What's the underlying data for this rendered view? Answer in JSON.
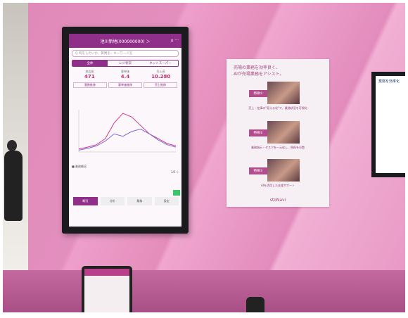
{
  "app": {
    "store_name": "池川新地(000000000) ＞",
    "header_icons": "⌂ ···",
    "search_placeholder": "Q 何をしたいか、質問を、キーワードを",
    "tabs": [
      "全体",
      "レジ状況",
      "ネットスーパー"
    ],
    "stats": [
      {
        "label": "来店客",
        "value": "471"
      },
      {
        "label": "客単価",
        "value": "4.4"
      },
      {
        "label": "売上高",
        "value": "10.280"
      }
    ],
    "subtabs": [
      "客数推移",
      "客単価推移",
      "売上推移"
    ],
    "footer_label": "■ 業務概況",
    "footer_right": "1/5 >",
    "buttons": [
      "概況",
      "分析",
      "業務",
      "設定"
    ]
  },
  "poster": {
    "title_line1": "売場の業務を効率良く、",
    "title_line2": "AIが売場業務をアシスト。",
    "features": [
      {
        "badge": "特徴①",
        "desc": "売上・在庫の\"見える化\"で、業務状況を可視化"
      },
      {
        "badge": "特徴②",
        "desc": "業務指示・タスクを一元化し、負担を分散"
      },
      {
        "badge": "特徴③",
        "desc": "AIを活用した支援サポート"
      }
    ],
    "brand": "stoNavi"
  },
  "right_screen_text": "業務を効率化",
  "chart_data": {
    "type": "line",
    "title": "",
    "xlabel": "",
    "ylabel": "",
    "series": [
      {
        "values": [
          5,
          8,
          12,
          22,
          48,
          64,
          58,
          44,
          30,
          22,
          14,
          10
        ]
      },
      {
        "values": [
          3,
          6,
          10,
          18,
          30,
          26,
          34,
          38,
          30,
          20,
          12,
          8
        ]
      }
    ],
    "ylim": [
      0,
      70
    ]
  }
}
